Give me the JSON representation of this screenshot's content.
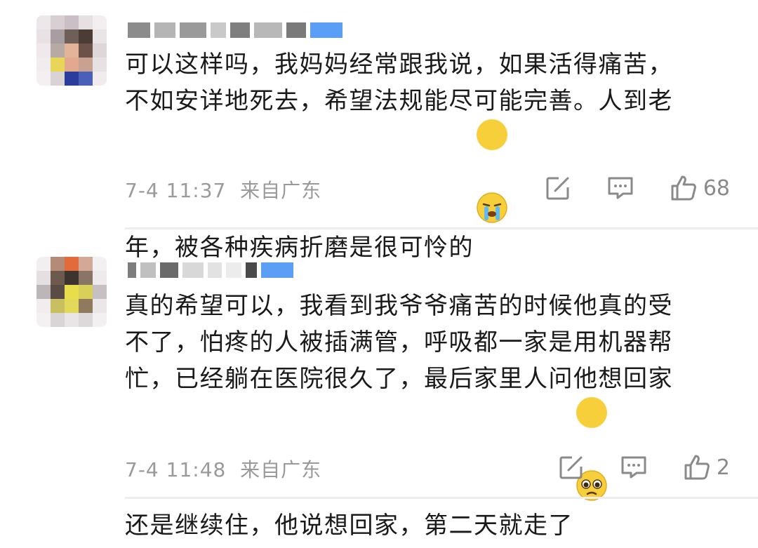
{
  "comments": [
    {
      "text_lines": [
        "可以这样吗，我妈妈经常跟我说，如果活得痛苦，",
        "不如安详地死去，希望法规能尽可能完善。人到老",
        "年，被各种疾病折磨是很可怜的"
      ],
      "emoji": "crying-face-emoji",
      "date": "7-4 11:37",
      "location": "来自广东",
      "like_count": "68"
    },
    {
      "text_lines": [
        "真的希望可以，我看到我爷爷痛苦的时候他真的受",
        "不了，怕疼的人被插满管，呼吸都一家是用机器帮",
        "忙，已经躺在医院很久了，最后家里人问他想回家",
        "还是继续住，他说想回家，第二天就走了"
      ],
      "emoji": "pleading-face-emoji",
      "date": "7-4 11:48",
      "location": "来自广东",
      "like_count": "2"
    }
  ],
  "colors": {
    "text": "#1a1a1a",
    "meta": "#9a9a9a",
    "icon": "#8a8a8a",
    "vip_badge": "#5b9ef5"
  }
}
